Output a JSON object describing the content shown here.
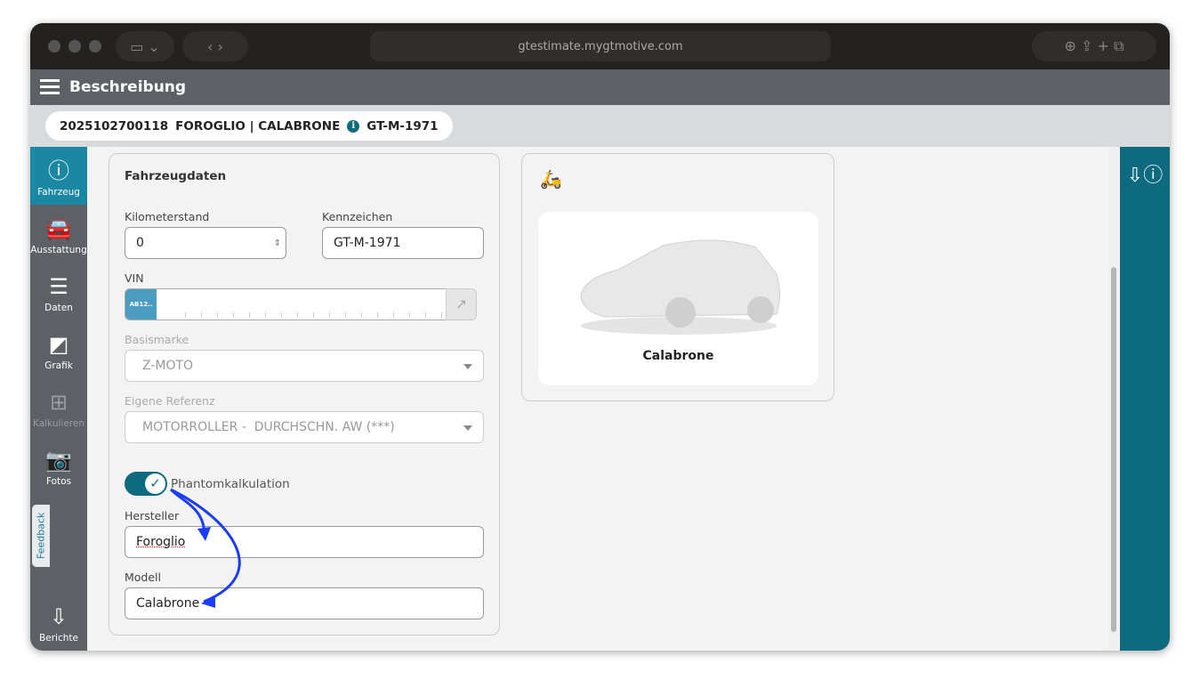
{
  "browser": {
    "url": "gtestimate.mygtmotive.com"
  },
  "app": {
    "title": "Beschreibung"
  },
  "chip": {
    "id": "2025102700118",
    "vehicle": "FOROGLIO | CALABRONE",
    "plate": "GT-M-1971"
  },
  "sidebar": {
    "items": [
      {
        "label": "Fahrzeug",
        "icon": "info-icon"
      },
      {
        "label": "Ausstattung",
        "icon": "car-icon"
      },
      {
        "label": "Daten",
        "icon": "list-star-icon"
      },
      {
        "label": "Grafik",
        "icon": "door-icon"
      },
      {
        "label": "Kalkulieren",
        "icon": "calculator-icon"
      },
      {
        "label": "Fotos",
        "icon": "camera-icon"
      }
    ],
    "feedback": "Feedback",
    "reports": "Berichte"
  },
  "form": {
    "title": "Fahrzeugdaten",
    "km_label": "Kilometerstand",
    "km_value": "0",
    "plate_label": "Kennzeichen",
    "plate_value": "GT-M-1971",
    "vin_label": "VIN",
    "vin_scan": "AB12..",
    "brand_label": "Basismarke",
    "brand_value": "Z-MOTO",
    "ref_label": "Eigene Referenz",
    "ref_value": "MOTORROLLER -  DURCHSCHN. AW (***)",
    "phantom_label": "Phantomkalkulation",
    "phantom_on": true,
    "maker_label": "Hersteller",
    "maker_value": "Foroglio",
    "model_label": "Modell",
    "model_value": "Calabrone"
  },
  "preview": {
    "name": "Calabrone"
  },
  "colors": {
    "teal": "#0e6a7f",
    "active": "#1a87a3",
    "arrow": "#1a3cff"
  }
}
